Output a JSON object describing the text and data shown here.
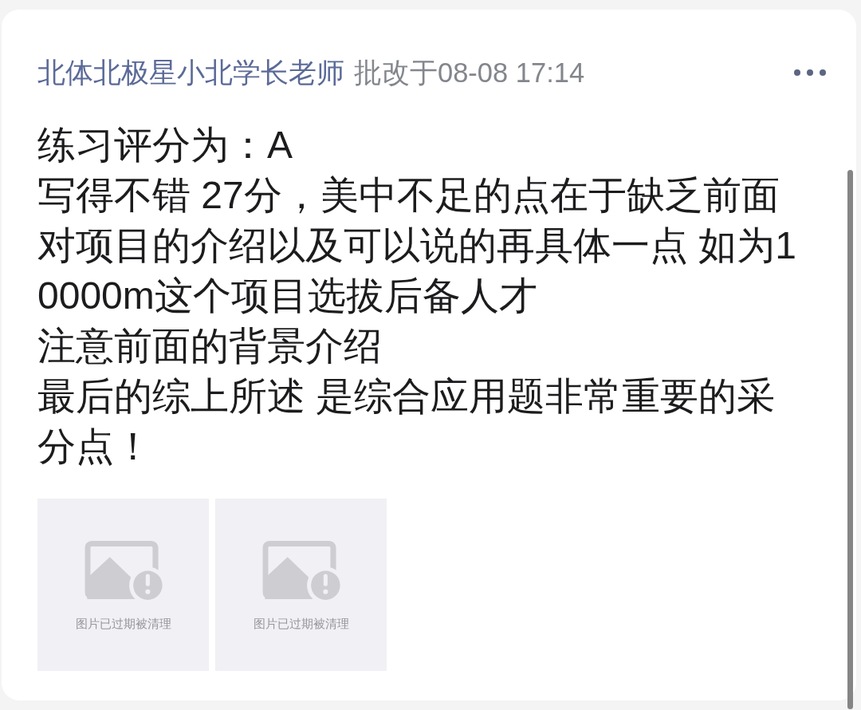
{
  "post": {
    "author": "北体北极星小北学长老师",
    "meta": "批改于08-08 17:14"
  },
  "comment": {
    "paragraphs": [
      "练习评分为：A",
      "写得不错 27分，美中不足的点在于缺乏前面对项目的介绍以及可以说的再具体一点 如为10000m这个项目选拔后备人才",
      "注意前面的背景介绍",
      "最后的综上所述 是综合应用题非常重要的采分点！"
    ]
  },
  "images": [
    {
      "expired": true,
      "caption": "图片已过期被清理"
    },
    {
      "expired": true,
      "caption": "图片已过期被清理"
    }
  ]
}
